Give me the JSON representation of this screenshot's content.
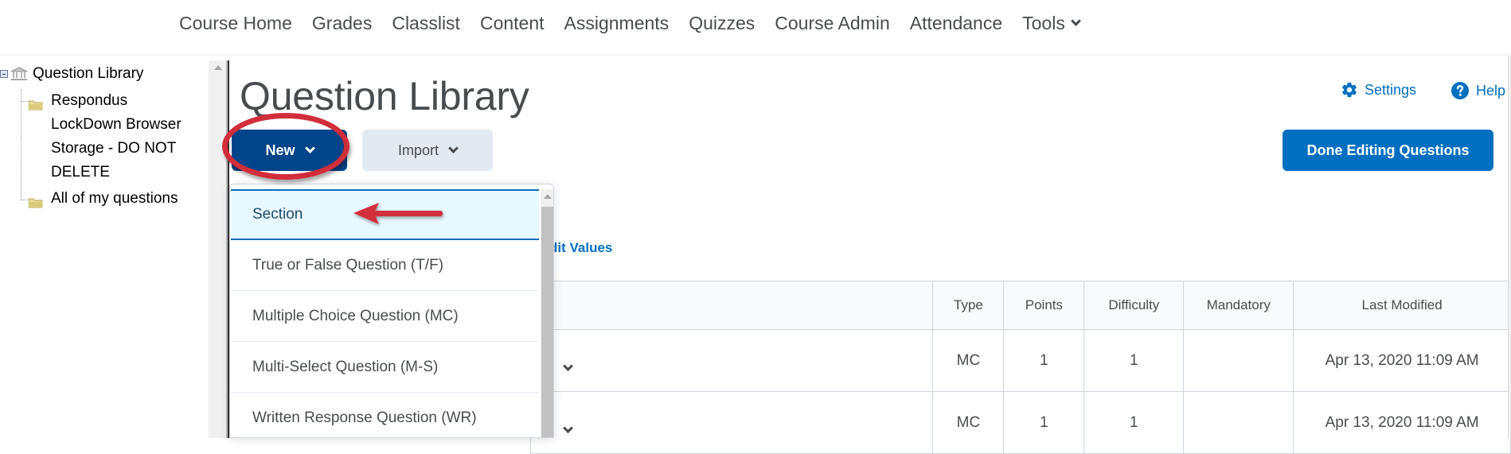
{
  "nav": {
    "items": [
      {
        "label": "Course Home"
      },
      {
        "label": "Grades"
      },
      {
        "label": "Classlist"
      },
      {
        "label": "Content"
      },
      {
        "label": "Assignments"
      },
      {
        "label": "Quizzes"
      },
      {
        "label": "Course Admin"
      },
      {
        "label": "Attendance"
      },
      {
        "label": "Tools",
        "has_dropdown": true
      }
    ]
  },
  "tree": {
    "root": {
      "label": "Question Library",
      "icon": "bank-icon",
      "expanded": true
    },
    "children": [
      {
        "label": "Respondus LockDown Browser Storage - DO NOT DELETE",
        "icon": "folder-icon"
      },
      {
        "label": "All of my questions",
        "icon": "folder-icon"
      }
    ]
  },
  "page": {
    "title": "Question Library",
    "settings_label": "Settings",
    "help_label": "Help"
  },
  "toolbar": {
    "new_label": "New",
    "import_label": "Import",
    "done_label": "Done Editing Questions",
    "edit_values_label": "dit Values"
  },
  "new_menu": {
    "items": [
      {
        "label": "Section",
        "active": true
      },
      {
        "label": "True or False Question (T/F)"
      },
      {
        "label": "Multiple Choice Question (MC)"
      },
      {
        "label": "Multi-Select Question (M-S)"
      },
      {
        "label": "Written Response Question (WR)"
      }
    ]
  },
  "table": {
    "headers": [
      "",
      "Type",
      "Points",
      "Difficulty",
      "Mandatory",
      "Last Modified"
    ],
    "rows": [
      {
        "type": "MC",
        "points": "1",
        "difficulty": "1",
        "mandatory": "",
        "last_modified": "Apr 13, 2020 11:09 AM"
      },
      {
        "type": "MC",
        "points": "1",
        "difficulty": "1",
        "mandatory": "",
        "last_modified": "Apr 13, 2020 11:09 AM"
      }
    ]
  },
  "colors": {
    "primary_dark": "#004489",
    "primary": "#006fbf",
    "annotation_red": "#d22d3b",
    "menu_active_bg": "#e8f8ff"
  }
}
